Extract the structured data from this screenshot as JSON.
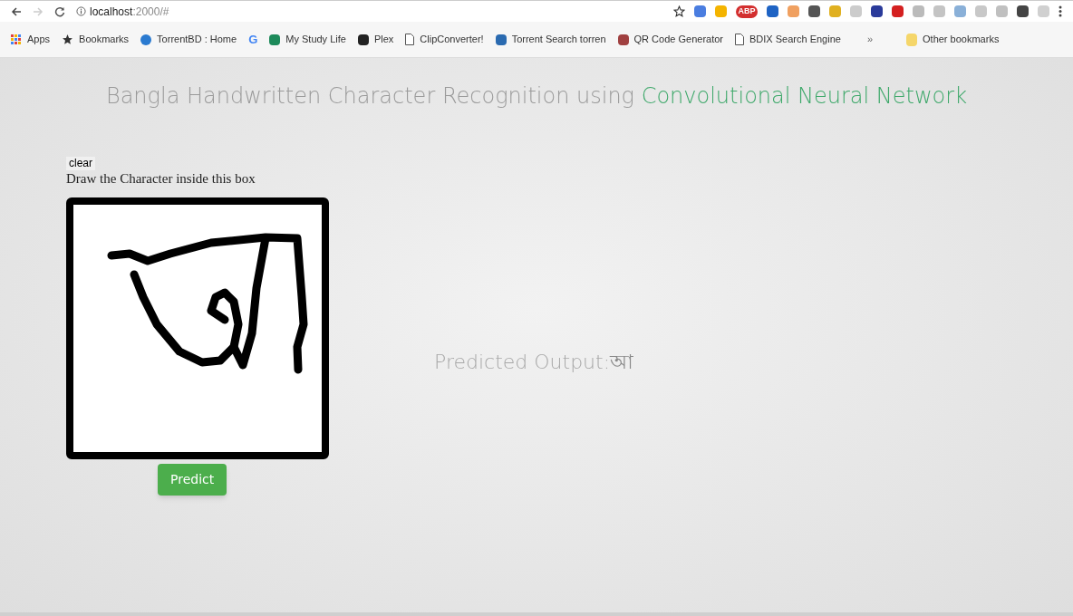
{
  "browser": {
    "url_host": "localhost",
    "url_rest": ":2000/#",
    "extensions": [
      {
        "color": "#4a7de0"
      },
      {
        "color": "#f4b400"
      },
      {
        "color": "#d32f2f",
        "label": "ABP"
      },
      {
        "color": "#1e63c4"
      },
      {
        "color": "#f0a060"
      },
      {
        "color": "#555555"
      },
      {
        "color": "#e0b020"
      },
      {
        "color": "#cccccc"
      },
      {
        "color": "#2a3a9a"
      },
      {
        "color": "#d42020"
      },
      {
        "color": "#bbbbbb"
      },
      {
        "color": "#c4c4c4"
      },
      {
        "color": "#8ab0d8"
      },
      {
        "color": "#c8c8c8"
      },
      {
        "color": "#c0c0c0"
      },
      {
        "color": "#444444"
      },
      {
        "color": "#d0d0d0"
      }
    ]
  },
  "bookmarks": [
    {
      "label": "Apps",
      "kind": "apps"
    },
    {
      "label": "Bookmarks",
      "kind": "star"
    },
    {
      "label": "TorrentBD : Home",
      "kind": "circle",
      "color": "#2a7ad0"
    },
    {
      "label": "G",
      "kind": "letter",
      "color": "#4285f4"
    },
    {
      "label": "My Study Life",
      "kind": "square",
      "color": "#1d8a5a"
    },
    {
      "label": "Plex",
      "kind": "square",
      "color": "#222222"
    },
    {
      "label": "ClipConverter!",
      "kind": "page"
    },
    {
      "label": "Torrent Search torren",
      "kind": "square",
      "color": "#2a6ab0"
    },
    {
      "label": "QR Code Generator",
      "kind": "square",
      "color": "#a04040"
    },
    {
      "label": "BDIX Search Engine",
      "kind": "page"
    },
    {
      "label": "»",
      "kind": "more"
    },
    {
      "label": "Other bookmarks",
      "kind": "folder"
    }
  ],
  "page": {
    "title": "Bangla Handwritten Character Recognition using ",
    "title_highlight": "Convolutional Neural Network",
    "clear_button": "clear",
    "instruction": "Draw the Character inside this box",
    "predict_button": "Predict",
    "output_label": "Predicted Output:",
    "output_value": "আ"
  }
}
